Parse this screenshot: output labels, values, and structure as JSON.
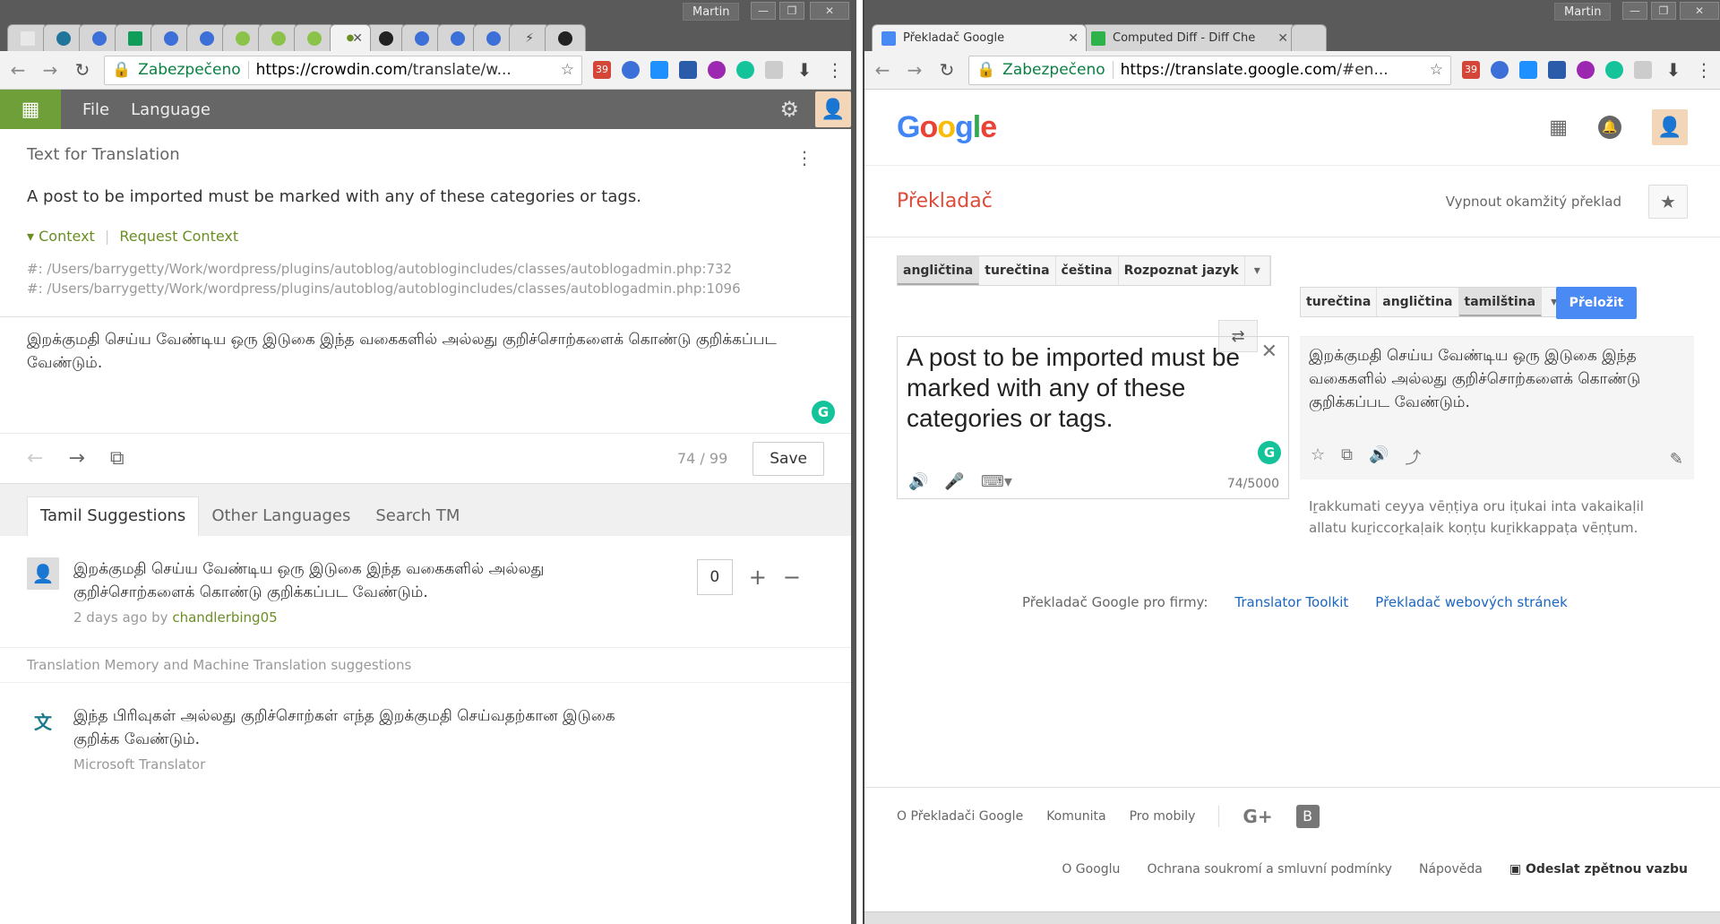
{
  "left": {
    "profile": "Martin",
    "address": {
      "secure": "Zabezpečeno",
      "url_domain": "https://crowdin.com",
      "url_rest": "/translate/w..."
    },
    "gmail_badge": "39",
    "menu": {
      "file": "File",
      "language": "Language"
    },
    "source": {
      "heading": "Text for Translation",
      "text": "A post to be imported must be marked with any of these categories or tags.",
      "context": "Context",
      "request_context": "Request Context",
      "refs": [
        "#: /Users/barrygetty/Work/wordpress/plugins/autoblog/autoblogincludes/classes/autoblogadmin.php:732",
        "#: /Users/barrygetty/Work/wordpress/plugins/autoblog/autoblogincludes/classes/autoblogadmin.php:1096"
      ]
    },
    "translation_text": "இறக்குமதி செய்ய வேண்டிய ஒரு இடுகை இந்த வகைகளில் அல்லது குறிச்சொற்களைக் கொண்டு குறிக்கப்பட வேண்டும்.",
    "counter": "74 / 99",
    "save": "Save",
    "tabs": [
      "Tamil Suggestions",
      "Other Languages",
      "Search TM"
    ],
    "suggestion": {
      "text": "இறக்குமதி செய்ய வேண்டிய ஒரு இடுகை இந்த வகைகளில் அல்லது குறிச்சொற்களைக் கொண்டு குறிக்கப்பட வேண்டும்.",
      "meta": "2 days ago by",
      "user": "chandlerbing05",
      "votes": "0"
    },
    "tm_label": "Translation Memory and Machine Translation suggestions",
    "mt": {
      "text": "இந்த பிரிவுகள் அல்லது குறிச்சொற்கள் எந்த இறக்குமதி செய்வதற்கான இடுகை குறிக்க வேண்டும்.",
      "source": "Microsoft Translator"
    }
  },
  "right": {
    "profile": "Martin",
    "tabs": [
      {
        "title": "Překladač Google"
      },
      {
        "title": "Computed Diff - Diff Che"
      }
    ],
    "address": {
      "secure": "Zabezpečeno",
      "url_domain": "https://translate.google.com",
      "url_rest": "/#en..."
    },
    "gmail_badge": "39",
    "logo": "Google",
    "title": "Překladač",
    "instant_off": "Vypnout okamžitý překlad",
    "source_langs": [
      "angličtina",
      "turečtina",
      "čeština",
      "Rozpoznat jazyk"
    ],
    "target_langs": [
      "turečtina",
      "angličtina",
      "tamilština"
    ],
    "translate_button": "Přeložit",
    "source_text": "A post to be imported must be marked with any of these categories or tags.",
    "char_count": "74/5000",
    "target_text": "இறக்குமதி செய்ய வேண்டிய ஒரு இடுகை இந்த வகைகளில் அல்லது குறிச்சொற்களைக் கொண்டு குறிக்கப்பட வேண்டும்.",
    "transliteration": "Iṟakkumati ceyya vēṇṭiya oru iṭukai inta vakaikaḷil allatu kuṟiccoṟkaḷaik koṇṭu kuṟikkappaṭa vēṇṭum.",
    "business": {
      "label": "Překladač Google pro firmy:",
      "toolkit": "Translator Toolkit",
      "web": "Překladač webových stránek"
    },
    "footer1": [
      "O Překladači Google",
      "Komunita",
      "Pro mobily"
    ],
    "footer2": [
      "O Googlu",
      "Ochrana soukromí a smluvní podmínky",
      "Nápověda"
    ],
    "feedback": "Odeslat zpětnou vazbu"
  }
}
